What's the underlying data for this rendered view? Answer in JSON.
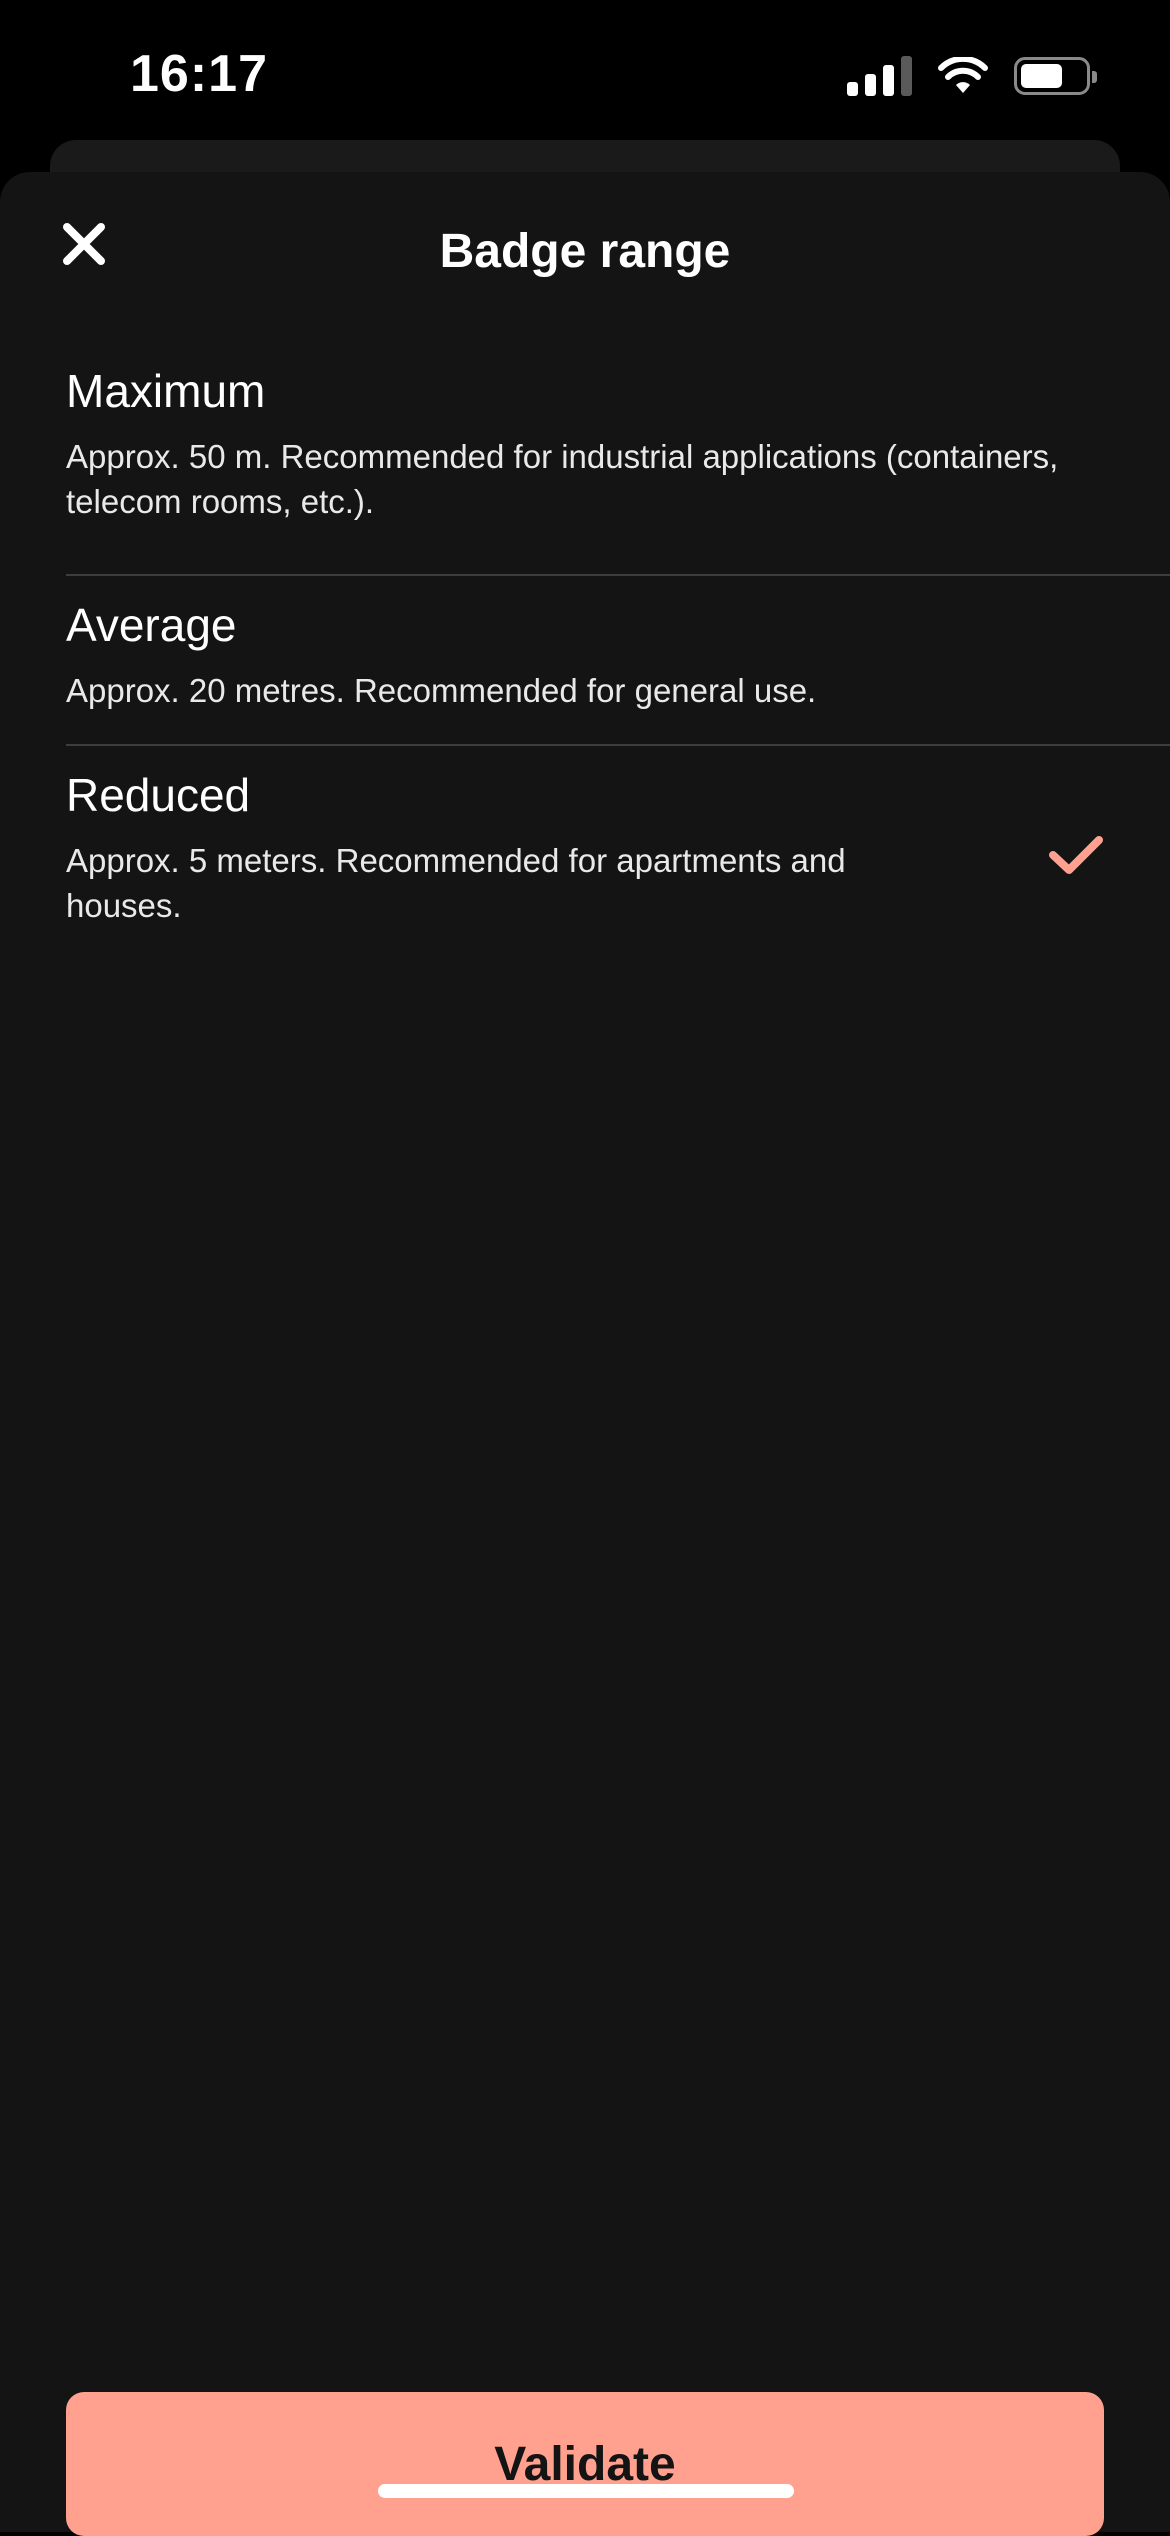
{
  "status_bar": {
    "time": "16:17",
    "icons": [
      "signal-icon",
      "wifi-icon",
      "battery-icon"
    ],
    "battery_level": 0.58
  },
  "header": {
    "title": "Badge range",
    "close_icon": "close-icon"
  },
  "options": [
    {
      "title": "Maximum",
      "description": "Approx. 50 m. Recommended for industrial applications (containers, telecom rooms, etc.).",
      "selected": false
    },
    {
      "title": "Average",
      "description": "Approx. 20 metres. Recommended for general use.",
      "selected": false
    },
    {
      "title": "Reduced",
      "description": "Approx. 5 meters. Recommended for apartments and houses.",
      "selected": true
    }
  ],
  "selected_icon": "check-icon",
  "footer": {
    "validate_label": "Validate"
  },
  "colors": {
    "accent": "#FFA18E",
    "background": "#141414",
    "button_text": "#141414",
    "divider": "#3D3D3D"
  }
}
